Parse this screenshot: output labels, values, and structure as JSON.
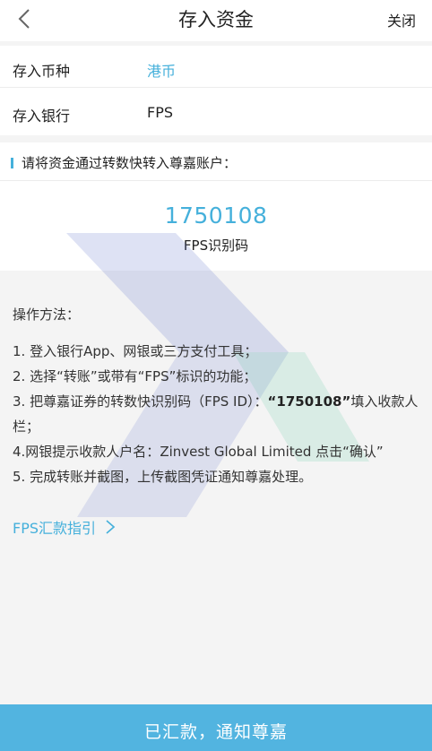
{
  "header": {
    "title": "存入资金",
    "close_label": "关闭"
  },
  "form": {
    "currency_label": "存入币种",
    "currency_value": "港币",
    "bank_label": "存入银行",
    "bank_value": "FPS"
  },
  "instruction": {
    "text": "请将资金通过转数快转入尊嘉账户："
  },
  "fps": {
    "code": "1750108",
    "code_label": "FPS识别码"
  },
  "steps": {
    "title": "操作方法：",
    "step1": "1. 登入银行App、网银或三方支付工具；",
    "step2": "2. 选择“转账”或带有“FPS”标识的功能；",
    "step3_pre": "3. 把尊嘉证券的转数快识别码（FPS ID）：",
    "step3_bold": "“1750108”",
    "step3_post": "填入收款人栏；",
    "step4": "4.网银提示收款人户名：Zinvest Global Limited 点击“确认”",
    "step5": "5. 完成转账并截图，上传截图凭证通知尊嘉处理。"
  },
  "guide_link": {
    "label": "FPS汇款指引"
  },
  "bottom_button": {
    "label": "已汇款，通知尊嘉"
  },
  "colors": {
    "accent": "#45b0db",
    "button": "#52b4e0"
  }
}
